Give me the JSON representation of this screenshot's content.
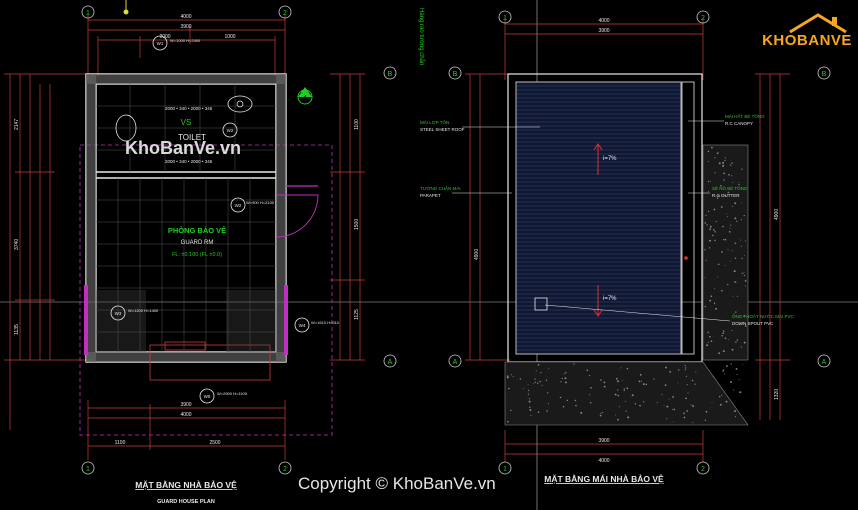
{
  "left_plan": {
    "title": "MẶT BẰNG NHÀ BẢO VỆ",
    "subtitle": "GUARD HOUSE PLAN",
    "room_name": "PHÒNG BẢO VỆ",
    "room_name_en": "GUARD RM",
    "level": "FL: ±0.100 (FL ±0.0)",
    "toilet_vn": "VS",
    "toilet_en": "TOILET",
    "dims_top": [
      "4000",
      "3900",
      "2000",
      "1000"
    ],
    "dims_bottom": [
      "1100",
      "2500"
    ],
    "dims_left": [
      "2147",
      "3740",
      "1135"
    ],
    "dims_right": [
      "1100",
      "1500",
      "1125"
    ],
    "grid_top": [
      "1",
      "2"
    ],
    "grid_side": [
      "B",
      "A",
      "A"
    ],
    "window_tags": [
      "W1",
      "W2",
      "W3",
      "W4",
      "W5"
    ],
    "window_sizes": [
      "W=1000 H=2400",
      "W=900 H=2100",
      "W=1200 H=1400",
      "W=1610 H=910",
      "W=2900 H=1100"
    ],
    "section_marker": "4",
    "note_top": "2000 • 340 • 2000 • 346"
  },
  "right_plan": {
    "title": "MẶT BẰNG MÁI NHÀ BẢO VỆ",
    "labels": [
      {
        "vn": "MÁI LỢP TÔN",
        "en": "STEEL SHEET ROOF"
      },
      {
        "vn": "TƯỜNG CHẮN MÁI",
        "en": "PARAPET"
      },
      {
        "vn": "MÁI HẮT BÊ TÔNG",
        "en": "R.C CANOPY"
      },
      {
        "vn": "SÊ NÔ BÊ TÔNG",
        "en": "R.C GUTTER"
      },
      {
        "vn": "ỐNG THOÁT NƯỚC MÁI PVC",
        "en": "DOWN SPOUT PVC"
      }
    ],
    "slopes": [
      "i=7%",
      "i=7%"
    ],
    "dims_top": [
      "4000",
      "3900"
    ],
    "dims_bottom": [
      "3900",
      "4000"
    ],
    "dims_left": [
      "4900",
      "1320"
    ],
    "grid_top": [
      "1",
      "2"
    ],
    "grid_side": [
      "B",
      "A"
    ]
  },
  "top_note": "Hàng rào tường chắn",
  "watermark": "KhoBanVe.vn",
  "copyright": "Copyright © KhoBanVe.vn",
  "logo": "KHOBANVE",
  "colors": {
    "background": "#000000",
    "dimension": "#c83c3c",
    "wall": "#e8e8e8",
    "magenta": "#c030c0",
    "roof_blue": "#3a4a8a",
    "green_text": "#22cc22",
    "yellow": "#dddd33",
    "grid_circle": "#cccccc"
  }
}
